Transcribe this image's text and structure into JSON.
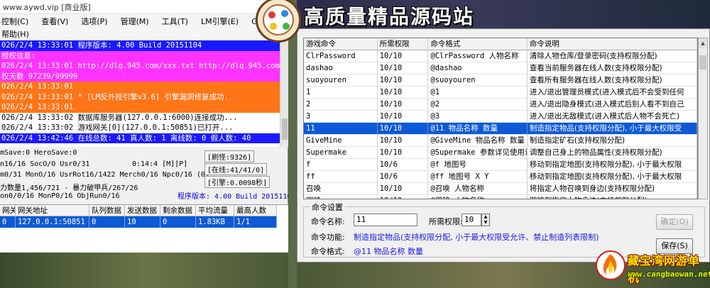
{
  "left_window": {
    "title": "www.aywd.vip [商业版]",
    "menu": [
      "控制(C)",
      "查看(V)",
      "选项(P)",
      "管理(M)",
      "工具(T)",
      "LM引擎(E)",
      "G盾PG"
    ],
    "help": "帮助(H)",
    "log_lines": [
      {
        "text": "026/2/4 13:33:01 程序版本: 4.00 Build 20151104",
        "style": "blue"
      },
      {
        "text": "授权信息:",
        "style": "mag"
      },
      {
        "text": "026/2/4 13:33:01 http://dlq.945.com/xxx.txt http://dlq.945.com/xxx.txt 授",
        "style": "mag"
      },
      {
        "text": "权天数 97239/99999",
        "style": "mag"
      },
      {
        "text": "026/2/4 13:33:01",
        "style": "orange"
      },
      {
        "text": "026/2/4 13:33:01 * [LM反外挂引擎v3.6] 引擎漏洞修复成功.",
        "style": "orange"
      },
      {
        "text": "026/2/4 13:33:01",
        "style": "orange"
      },
      {
        "text": "026/2/4 13:33:02 数据库服务器(127.0.0.1:6000)连接成功...",
        "style": "plain"
      },
      {
        "text": "026/2/4 13:33:02 游戏网关[0](127.0.0.1:50851)已打开...",
        "style": "plain"
      },
      {
        "text": "026/2/4 13:42:46 在线总数: 41 真人数: 1 离线数: 0 假人数: 40",
        "style": "blue"
      }
    ],
    "status": {
      "line1": "mSave:0 HeroSave:0",
      "line2": "n16/16 SocO/O Usr0/31",
      "time": "0:14:4 [M][P]",
      "line3": "m0/31 MonO/16 UsrRot16/1422 Merch0/16 Npc0/16 (0)",
      "line4": "力数量1,456/721 - 暴力破甲兵/267/26",
      "line5": "on0/0/16 MonP0/16 ObjRun0/16",
      "box1": "[刷怪:9326]",
      "box2": "[在线:41/41/0]",
      "box3": "[引擎:0.0098秒]",
      "version": "程序版本: 4.00 Build 20151104"
    },
    "gateway_table": {
      "headers": [
        "网关",
        "网关地址",
        "队列数据",
        "发送数据",
        "剩余数据",
        "平均流量",
        "最高人数"
      ],
      "rows": [
        [
          "0",
          "127.0.0.1:50851",
          "0",
          "10",
          "0",
          "1.83KB",
          "1/1"
        ]
      ]
    }
  },
  "banner": {
    "title": "高质量精品源码站"
  },
  "command_dialog": {
    "columns": [
      "游戏命令",
      "所需权限",
      "命令格式",
      "命令说明"
    ],
    "rows": [
      [
        "ClrPassword",
        "10/10",
        "@ClrPassword 人物名称",
        "清除人物仓库/登录密码(支持权限分配)"
      ],
      [
        "dashao",
        "10/10",
        "@dashao",
        "查看当前服务器在线人数(支持权限分配)"
      ],
      [
        "suoyouren",
        "10/10",
        "@suoyouren",
        "查看所有服务器在线人数(支持权限分配)"
      ],
      [
        "1",
        "10/10",
        "@1",
        "进入/退出管理员模式(进入模式后不会受到任何"
      ],
      [
        "2",
        "10/10",
        "@2",
        "进入/退出隐身模式(进入模式后别人看不到自己"
      ],
      [
        "3",
        "10/10",
        "@3",
        "进入/退出无敌模式(进入模式后人物不会死亡)"
      ],
      [
        "11",
        "10/10",
        "@11 物品名称 数量",
        "制造指定物品(支持权限分配), 小于最大权限受"
      ],
      [
        "GiveMine",
        "10/10",
        "@GiveMine 物品名称 数量 当前",
        "制造指定矿石(支持权限分配)"
      ],
      [
        "Supermake",
        "10/10",
        "@Supermake 参数详见使用说明",
        "调整自己身上的物品属性(支持权限分配)"
      ],
      [
        "f",
        "10/6",
        "@f 地图号",
        "移动到指定地图(支持权限分配), 小于最大权限"
      ],
      [
        "ff",
        "10/6",
        "@ff 地图号 X Y",
        "移动到指定地图(支持权限分配), 小于最大权限"
      ],
      [
        "召唤",
        "10/10",
        "@召唤 人物名称",
        "将指定人物召唤到身边(支持权限分配)"
      ],
      [
        "即移",
        "10/10",
        "@即移 人物名称",
        "即移到指定人物身边(支持权限分配)"
      ]
    ],
    "selected_row": 6,
    "settings": {
      "group_label": "命令设置",
      "name_label": "命令名称:",
      "name_value": "11",
      "perm_label": "所需权限:",
      "perm_value": "10",
      "func_label": "命令功能:",
      "func_value": "制造指定物品(支持权限分配, 小于最大权限受允许、禁止制造列表限制)",
      "format_label": "命令格式:",
      "format_value": "@11 物品名称 数量",
      "ok_label": "确定(O)",
      "save_label": "保存(S)"
    }
  },
  "watermark": {
    "name": "藏宝湾网游单机",
    "url": "www.cangbaowan.net"
  },
  "colors": {
    "log_blue": "#1a1aff",
    "log_magenta": "#ff33ff",
    "log_orange": "#ff7518",
    "selection": "#0c5ad6"
  }
}
